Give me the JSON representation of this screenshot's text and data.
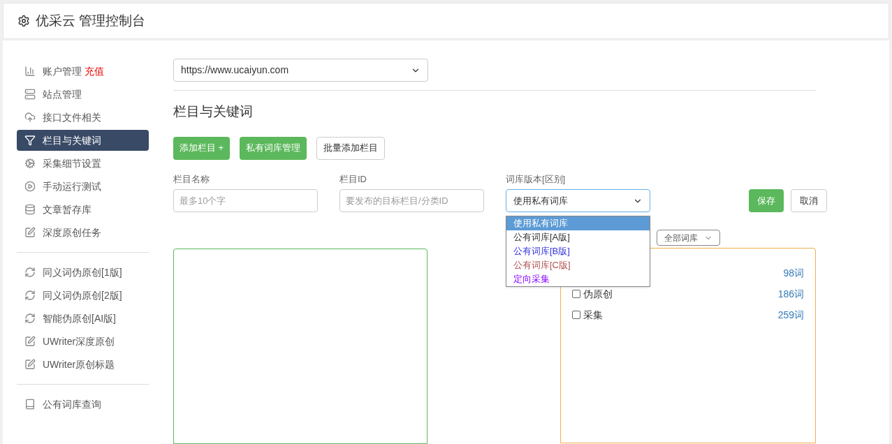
{
  "header": {
    "title": "优采云 管理控制台"
  },
  "sidebar": {
    "groups": [
      {
        "items": [
          {
            "label": "账户管理",
            "badge": "充值",
            "selected": false
          },
          {
            "label": "站点管理",
            "selected": false
          },
          {
            "label": "接口文件相关",
            "selected": false
          },
          {
            "label": "栏目与关键词",
            "selected": true
          },
          {
            "label": "采集细节设置",
            "selected": false
          },
          {
            "label": "手动运行测试",
            "selected": false
          },
          {
            "label": "文章暂存库",
            "selected": false
          },
          {
            "label": "深度原创任务",
            "selected": false
          }
        ]
      },
      {
        "items": [
          {
            "label": "同义词伪原创[1版]",
            "selected": false
          },
          {
            "label": "同义词伪原创[2版]",
            "selected": false
          },
          {
            "label": "智能伪原创[AI版]",
            "selected": false
          },
          {
            "label": "UWriter深度原创",
            "selected": false
          },
          {
            "label": "UWriter原创标题",
            "selected": false
          }
        ]
      },
      {
        "items": [
          {
            "label": "公有词库查询",
            "selected": false
          }
        ]
      }
    ]
  },
  "site_select": {
    "value": "https://www.ucaiyun.com"
  },
  "section_title": "栏目与关键词",
  "actions": [
    {
      "label": "添加栏目 +",
      "kind": "green"
    },
    {
      "label": "私有词库管理",
      "kind": "green"
    },
    {
      "label": "批量添加栏目",
      "kind": "plain"
    }
  ],
  "form": {
    "fields": [
      {
        "label": "栏目名称",
        "placeholder": "最多10个字"
      },
      {
        "label": "栏目ID",
        "placeholder": "要发布的目标栏目/分类ID"
      }
    ],
    "library": {
      "label": "词库版本[区别]",
      "value": "使用私有词库",
      "options": [
        {
          "label": "使用私有词库",
          "selected": true
        },
        {
          "label": "公有词库[A版]",
          "selected": false,
          "color": "#333333"
        },
        {
          "label": "公有词库[B版]",
          "selected": false,
          "color": "#3333dd"
        },
        {
          "label": "公有词库[C版]",
          "selected": false,
          "color": "#b05050"
        },
        {
          "label": "定向采集",
          "selected": false,
          "color": "#8800ff"
        }
      ]
    },
    "save": "保存",
    "cancel": "取消"
  },
  "library_filter": {
    "value": "全部词库"
  },
  "library_list": [
    {
      "count": "98词"
    },
    {
      "name": "伪原创",
      "count": "186词",
      "checked": false
    },
    {
      "name": "采集",
      "count": "259词",
      "checked": false
    }
  ]
}
